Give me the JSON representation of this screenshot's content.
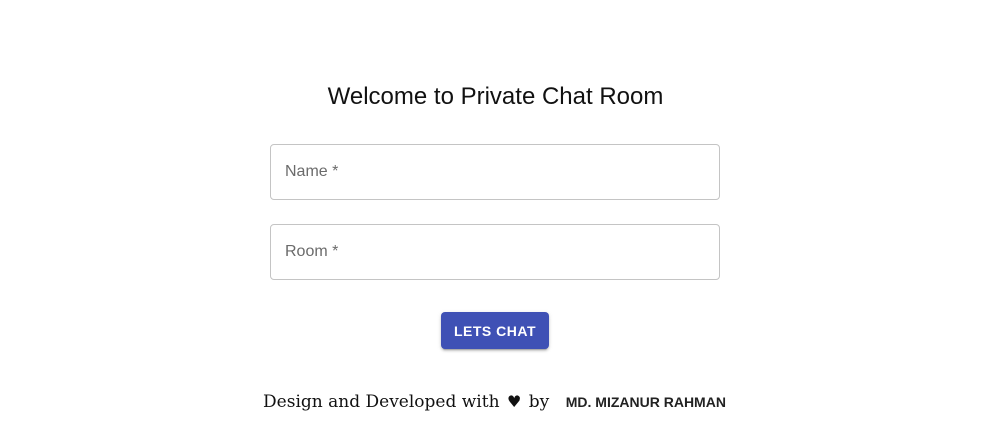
{
  "title": "Welcome to Private Chat Room",
  "form": {
    "name_placeholder": "Name *",
    "name_value": "",
    "room_placeholder": "Room *",
    "room_value": "",
    "submit_label": "LETS CHAT"
  },
  "footer": {
    "text_before": "Design and Developed with",
    "heart_icon": "heart-icon",
    "text_after": "by",
    "author": "MD. MIZANUR RAHMAN"
  },
  "colors": {
    "primary": "#3f51b5",
    "border": "#c4c4c4",
    "text": "#111111"
  }
}
